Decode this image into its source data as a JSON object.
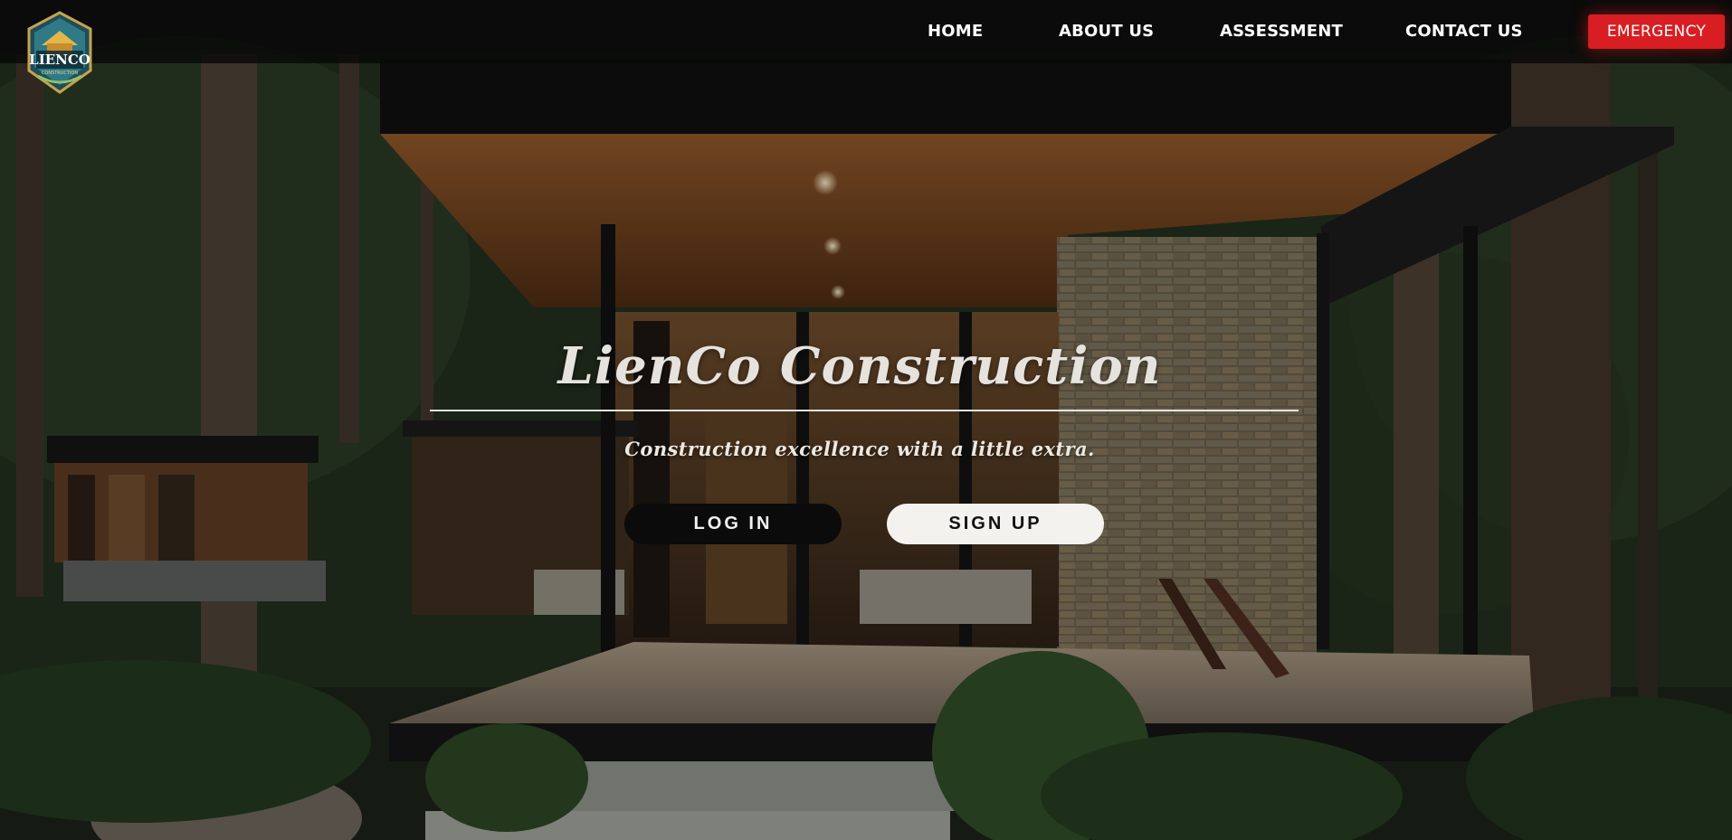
{
  "nav": {
    "links": [
      "HOME",
      "ABOUT US",
      "ASSESSMENT",
      "CONTACT US"
    ],
    "emergency_label": "EMERGENCY"
  },
  "logo": {
    "main_text": "LIENCO",
    "sub_text": "CONSTRUCTION"
  },
  "hero": {
    "title": "LienCo Construction",
    "tagline": "Construction excellence with a little extra.",
    "login_label": "LOG IN",
    "signup_label": "SIGN UP"
  },
  "colors": {
    "accent_red": "#d81e22",
    "text_light": "#e6e2dd"
  }
}
